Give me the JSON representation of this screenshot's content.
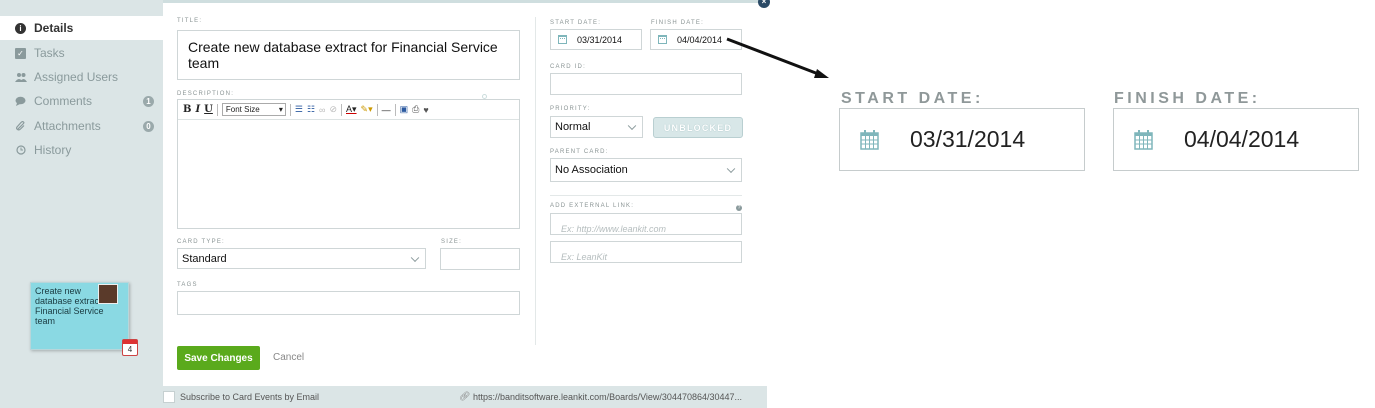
{
  "sidebar": {
    "items": [
      {
        "label": "Details",
        "icon": "info-icon",
        "glyph": "i"
      },
      {
        "label": "Tasks",
        "icon": "checkbox-icon",
        "glyph": "☑"
      },
      {
        "label": "Assigned Users",
        "icon": "users-icon",
        "glyph": "👥"
      },
      {
        "label": "Comments",
        "icon": "comment-icon",
        "glyph": "●",
        "badge": "1"
      },
      {
        "label": "Attachments",
        "icon": "paperclip-icon",
        "glyph": "✎",
        "badge": "0"
      },
      {
        "label": "History",
        "icon": "clock-icon",
        "glyph": "◷"
      }
    ],
    "card_preview": {
      "title": "Create new database extract for Financial Service team",
      "due_day": "4"
    }
  },
  "form": {
    "title_label": "TITLE:",
    "title_value": "Create new database extract for Financial Service team",
    "description_label": "DESCRIPTION:",
    "toolbar": {
      "bold": "B",
      "italic": "I",
      "underline": "U",
      "font_size": "Font Size"
    },
    "card_type_label": "CARD TYPE:",
    "card_type_value": "Standard",
    "size_label": "SIZE:",
    "size_value": "",
    "tags_label": "TAGS",
    "tags_value": "",
    "save_label": "Save Changes",
    "cancel_label": "Cancel",
    "start_date_label": "START DATE:",
    "start_date_value": "03/31/2014",
    "finish_date_label": "FINISH DATE:",
    "finish_date_value": "04/04/2014",
    "card_id_label": "CARD ID:",
    "card_id_value": "",
    "priority_label": "PRIORITY:",
    "priority_value": "Normal",
    "unblocked_label": "UNBLOCKED",
    "parent_card_label": "PARENT CARD:",
    "parent_card_value": "No Association",
    "external_link_label": "ADD EXTERNAL LINK:",
    "external_link_url_placeholder": "Ex: http://www.leankit.com",
    "external_link_name_placeholder": "Ex: LeanKit"
  },
  "footer": {
    "subscribe_label": "Subscribe to Card Events by Email",
    "url": "https://banditsoftware.leankit.com/Boards/View/304470864/30447..."
  },
  "zoom": {
    "start_label": "START DATE:",
    "start_value": "03/31/2014",
    "finish_label": "FINISH DATE:",
    "finish_value": "04/04/2014"
  },
  "colors": {
    "save_button": "#5aaa1c",
    "sidebar_bg": "#dbe5e6",
    "card_color": "#8ad9e3"
  }
}
